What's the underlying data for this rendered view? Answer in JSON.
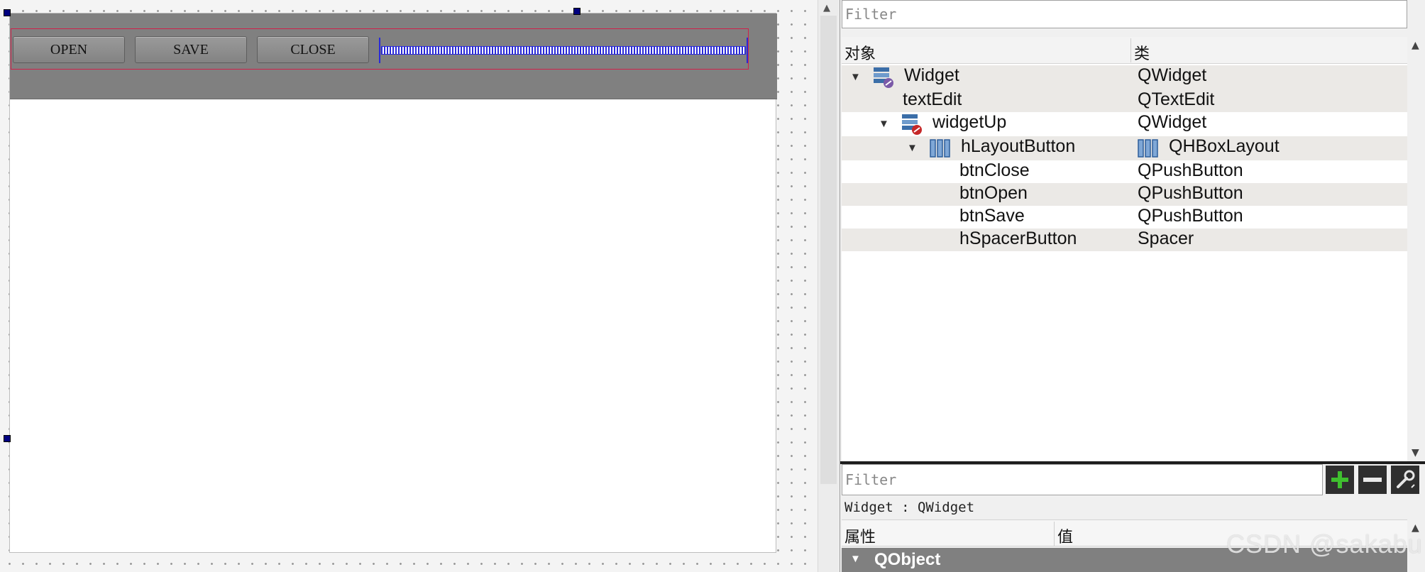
{
  "form": {
    "buttons": {
      "open": "OPEN",
      "save": "SAVE",
      "close": "CLOSE"
    }
  },
  "object_inspector": {
    "filter_placeholder": "Filter",
    "columns": {
      "object": "对象",
      "class": "类"
    },
    "rows": [
      {
        "object": "Widget",
        "class": "QWidget",
        "icon": "widget-icon"
      },
      {
        "object": "textEdit",
        "class": "QTextEdit",
        "icon": ""
      },
      {
        "object": "widgetUp",
        "class": "QWidget",
        "icon": "widget-icon"
      },
      {
        "object": "hLayoutButton",
        "class": "QHBoxLayout",
        "icon": "hbox-layout-icon"
      },
      {
        "object": "btnClose",
        "class": "QPushButton",
        "icon": ""
      },
      {
        "object": "btnOpen",
        "class": "QPushButton",
        "icon": ""
      },
      {
        "object": "btnSave",
        "class": "QPushButton",
        "icon": ""
      },
      {
        "object": "hSpacerButton",
        "class": "Spacer",
        "icon": ""
      }
    ]
  },
  "property_editor": {
    "filter_placeholder": "Filter",
    "selected_object": "Widget : QWidget",
    "columns": {
      "property": "属性",
      "value": "值"
    },
    "group": "QObject",
    "toolbar": {
      "add_icon": "plus-icon",
      "remove_icon": "minus-icon",
      "config_icon": "wrench-icon"
    }
  },
  "watermark": "CSDN @sakabu",
  "colors": {
    "panel_gray": "#808080",
    "alt_row": "#ebe9e6",
    "selection_handle": "#000080",
    "spacer_blue": "#2a2ad8",
    "layout_red": "#d0204a",
    "add_green": "#3fbf2f"
  }
}
